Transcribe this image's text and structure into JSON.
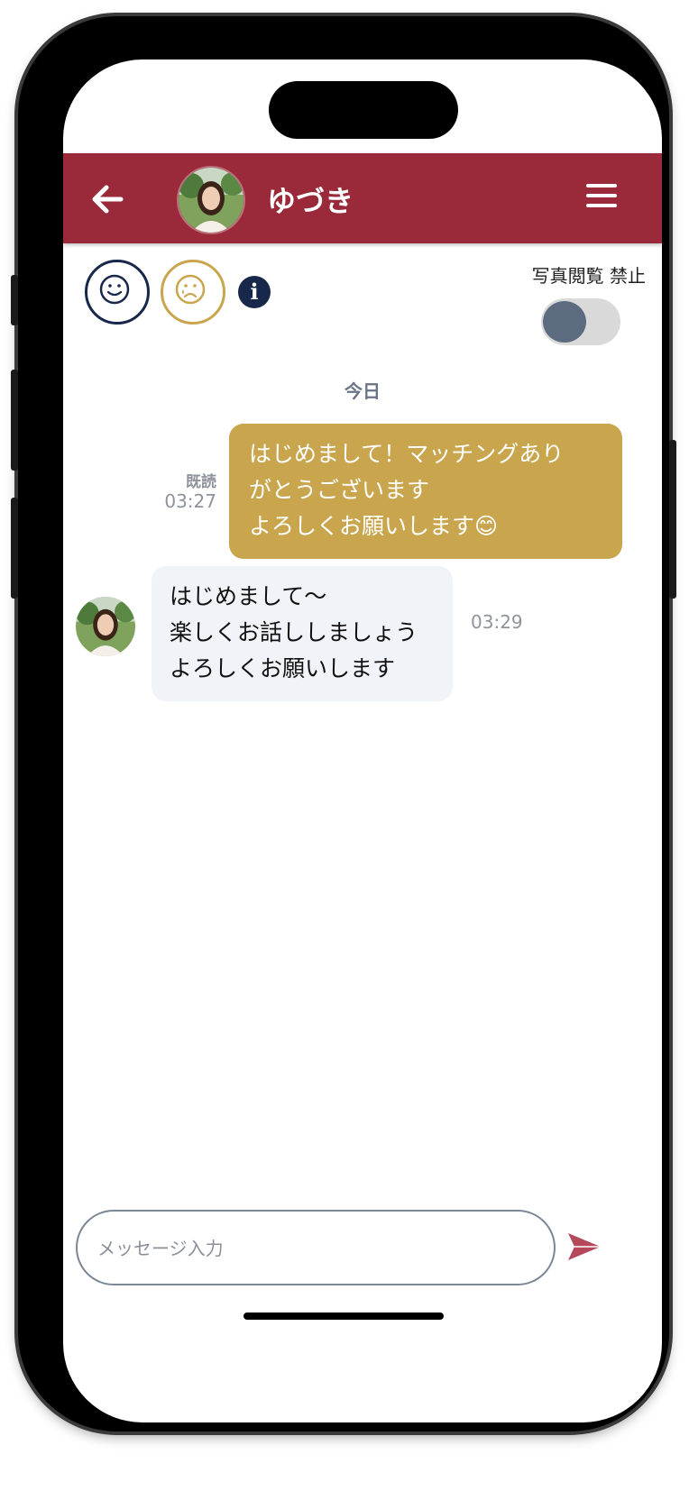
{
  "header": {
    "contact_name": "ゆづき",
    "back_icon": "arrow-left-icon",
    "menu_icon": "hamburger-menu-icon",
    "color": "#9a2a3a"
  },
  "toolbar": {
    "smile_icon": "smile-face-icon",
    "sad_icon": "sad-face-icon",
    "info_label": "i",
    "photo_view_label": "写真閲覧 禁止",
    "photo_toggle_on": false
  },
  "chat": {
    "date_separator": "今日",
    "messages": [
      {
        "direction": "outgoing",
        "lines": [
          "はじめまして！マッチングあり",
          "がとうございます",
          "よろしくお願いします😊"
        ],
        "status": "既読",
        "time": "03:27"
      },
      {
        "direction": "incoming",
        "lines": [
          "はじめまして〜",
          "楽しくお話ししましょう",
          "よろしくお願いします"
        ],
        "time": "03:29"
      }
    ]
  },
  "composer": {
    "placeholder": "メッセージ入力",
    "value": "",
    "send_icon": "send-icon"
  },
  "colors": {
    "accent": "#9a2a3a",
    "gold": "#c9a64e",
    "navy": "#17284a"
  }
}
